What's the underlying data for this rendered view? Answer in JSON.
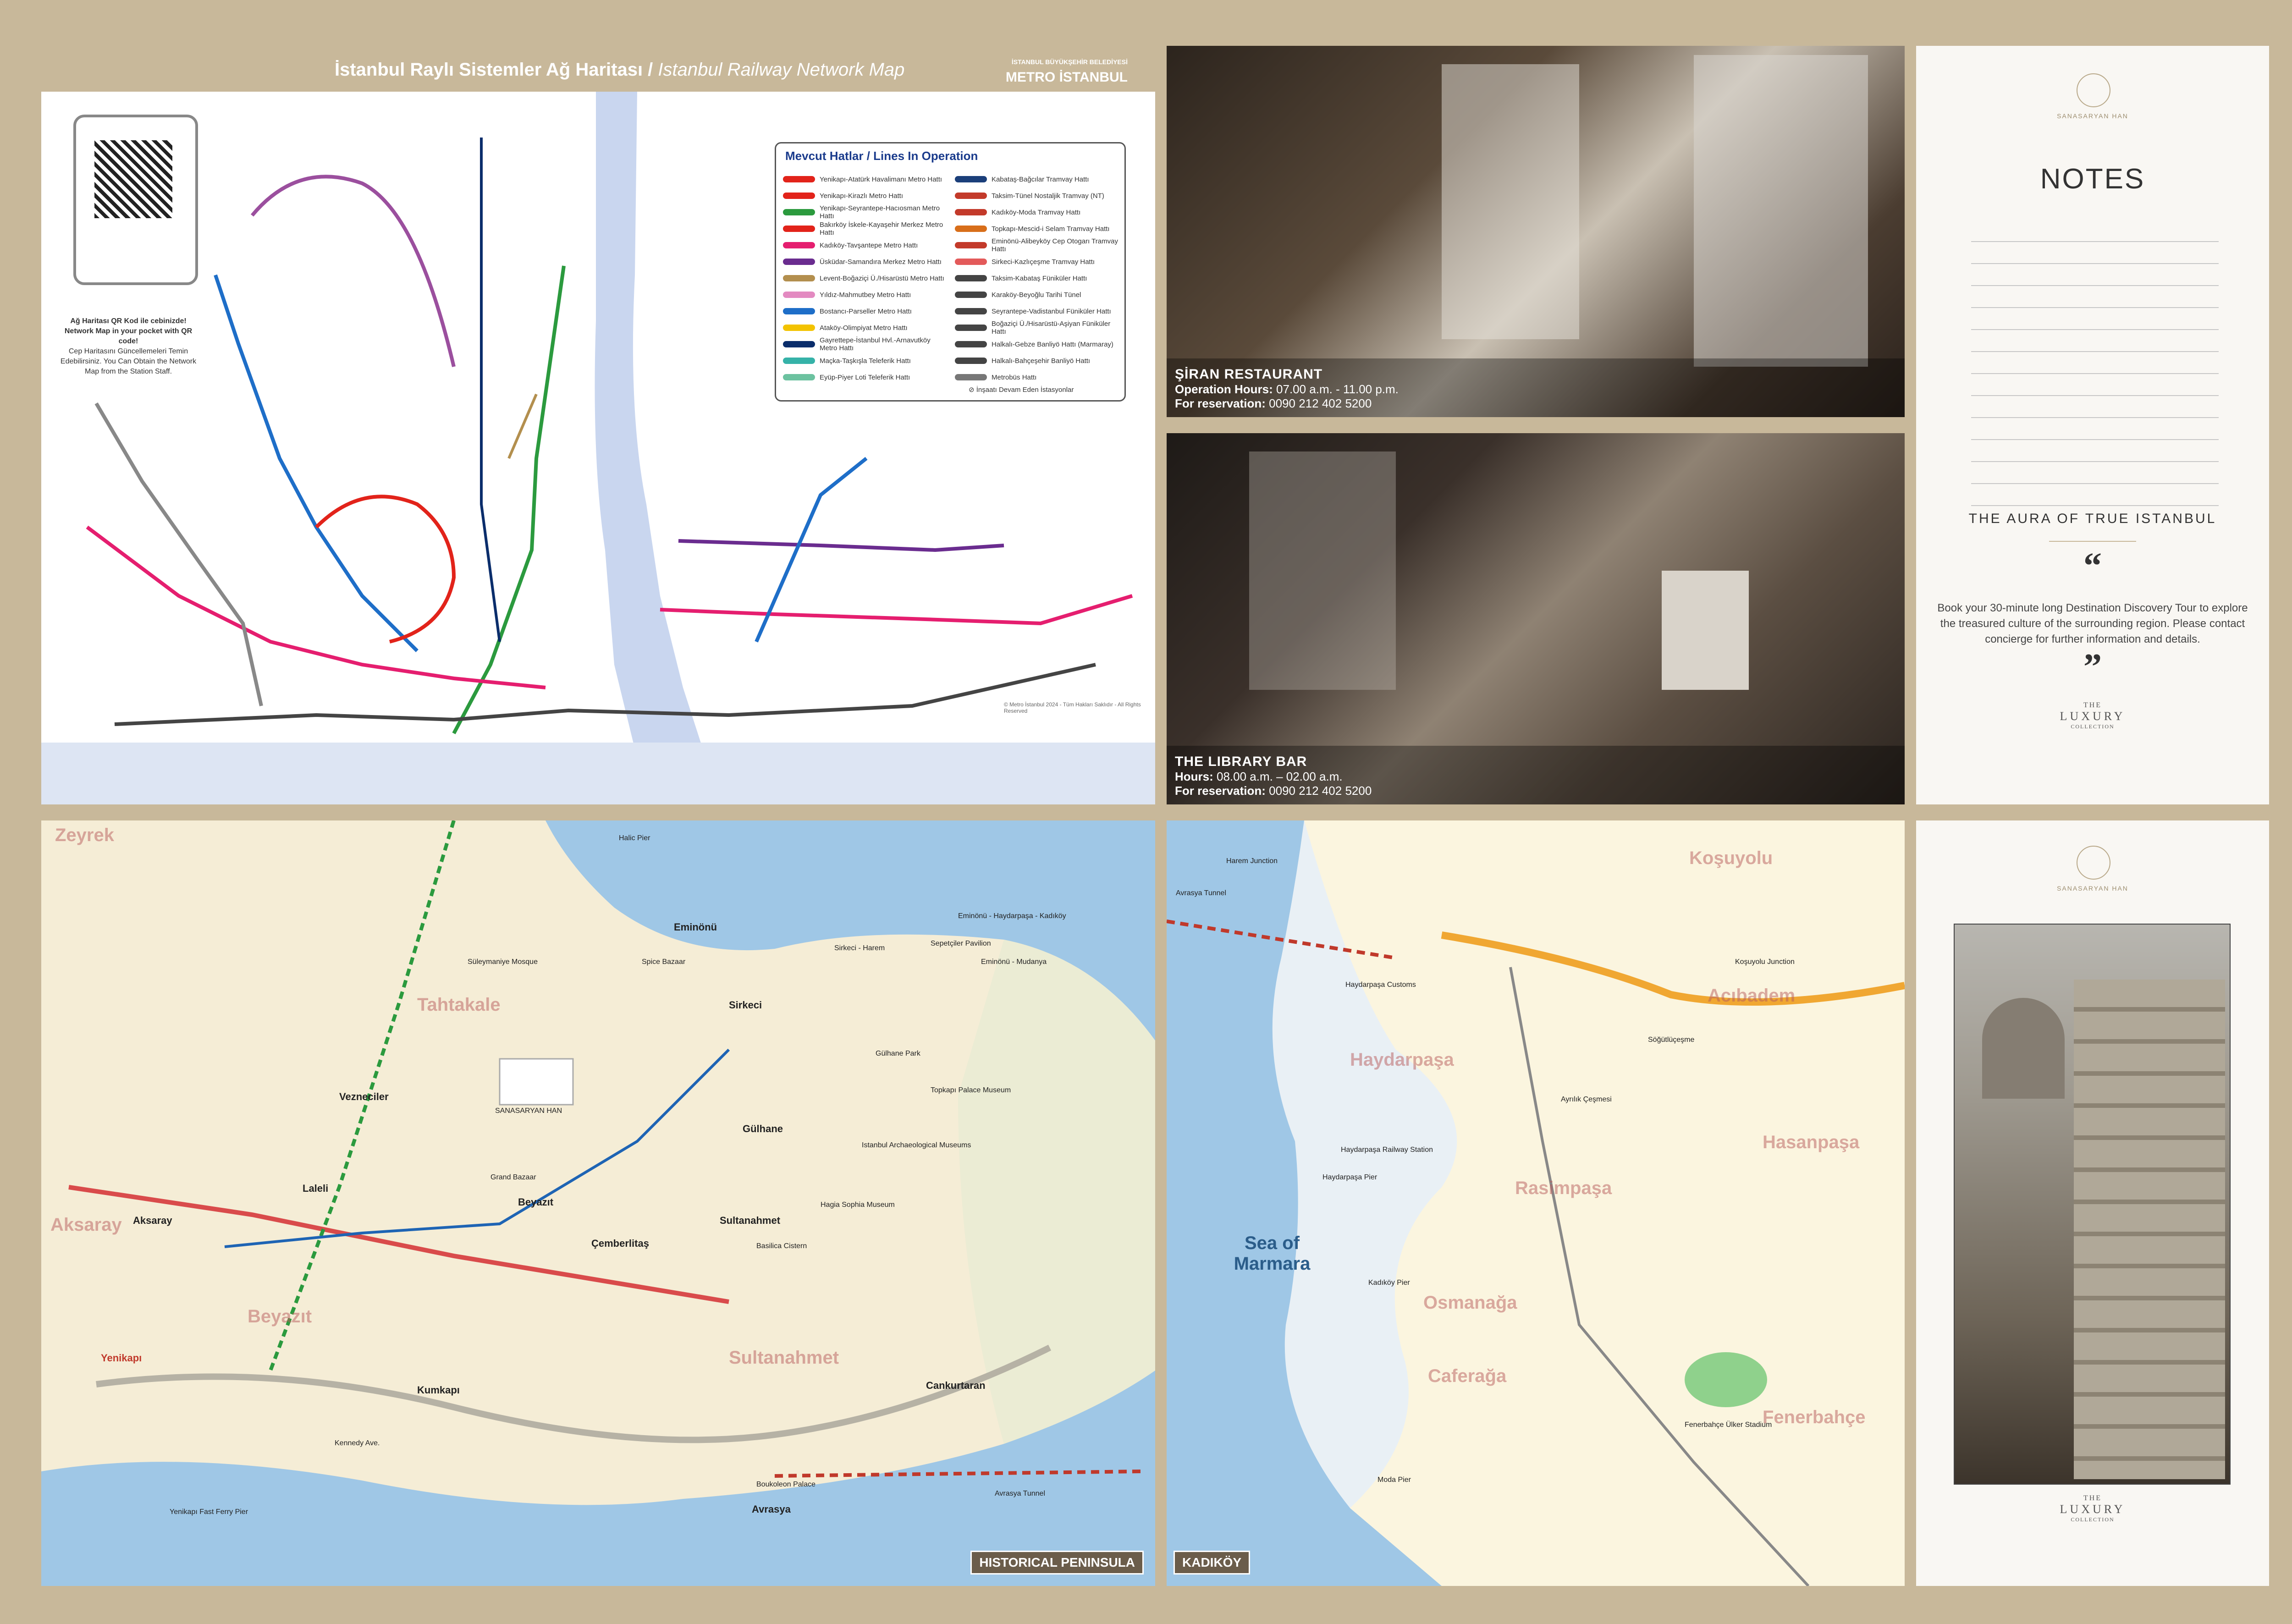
{
  "metro": {
    "title_tr": "İstanbul Raylı Sistemler Ağ Haritası / ",
    "title_en": "Istanbul Railway Network Map",
    "brand_left": "İSTANBUL BÜYÜKŞEHİR BELEDİYESİ",
    "brand_right": "METRO İSTANBUL",
    "qr_title_tr": "Ağ Haritası QR Kod ile cebinizde!",
    "qr_title_en": "Network Map in your pocket with QR code!",
    "qr_sub": "Cep Haritasını Güncellemeleri Temin Edebilirsiniz. You Can Obtain the Network Map from the Station Staff.",
    "legend_title": "Mevcut Hatlar / Lines In Operation",
    "legend_left": [
      {
        "label": "Yenikapı-Atatürk Havalimanı Metro Hattı",
        "color": "#e2231a"
      },
      {
        "label": "Yenikapı-Kirazlı Metro Hattı",
        "color": "#e2231a"
      },
      {
        "label": "Yenikapı-Seyrantepe-Hacıosman Metro Hattı",
        "color": "#2b9a3e"
      },
      {
        "label": "Bakırköy İskele-Kayaşehir Merkez Metro Hattı",
        "color": "#e2231a"
      },
      {
        "label": "Kadıköy-Tavşantepe Metro Hattı",
        "color": "#e51e6f"
      },
      {
        "label": "Üsküdar-Samandıra Merkez Metro Hattı",
        "color": "#6a2c8f"
      },
      {
        "label": "Levent-Boğaziçi Ü./Hisarüstü Metro Hattı",
        "color": "#b38f4e"
      },
      {
        "label": "Yıldız-Mahmutbey Metro Hattı",
        "color": "#e38ac1"
      },
      {
        "label": "Bostancı-Parseller Metro Hattı",
        "color": "#1e6ec8"
      },
      {
        "label": "Ataköy-Olimpiyat Metro Hattı",
        "color": "#f3c300"
      },
      {
        "label": "Gayrettepe-İstanbul Hvl.-Arnavutköy Metro Hattı",
        "color": "#0a2d6b"
      },
      {
        "label": "Maçka-Taşkışla Teleferik Hattı",
        "color": "#35b2a8"
      },
      {
        "label": "Eyüp-Piyer Loti Teleferik Hattı",
        "color": "#6cc2a0"
      }
    ],
    "legend_right": [
      {
        "label": "Kabataş-Bağcılar Tramvay Hattı",
        "color": "#1b3f7a"
      },
      {
        "label": "Taksim-Tünel Nostaljik Tramvay (NT)",
        "color": "#c33a2a"
      },
      {
        "label": "Kadıköy-Moda Tramvay Hattı",
        "color": "#c33a2a"
      },
      {
        "label": "Topkapı-Mescid-i Selam Tramvay Hattı",
        "color": "#d86e1a"
      },
      {
        "label": "Eminönü-Alibeyköy Cep Otogarı Tramvay Hattı",
        "color": "#c33a2a"
      },
      {
        "label": "Sirkeci-Kazlıçeşme Tramvay Hattı",
        "color": "#e35a5a"
      },
      {
        "label": "Taksim-Kabataş Füniküler Hattı",
        "color": "#444"
      },
      {
        "label": "Karaköy-Beyoğlu Tarihi Tünel",
        "color": "#444"
      },
      {
        "label": "Seyrantepe-Vadistanbul Füniküler Hattı",
        "color": "#444"
      },
      {
        "label": "Boğaziçi Ü./Hisarüstü-Aşiyan Füniküler Hattı",
        "color": "#444"
      },
      {
        "label": "Halkalı-Gebze Banliyö Hattı (Marmaray)",
        "color": "#444"
      },
      {
        "label": "Halkalı-Bahçeşehir Banliyö Hattı",
        "color": "#444"
      },
      {
        "label": "Metrobüs Hattı",
        "color": "#777"
      }
    ],
    "legend_note": "İnşaatı Devam Eden İstasyonlar",
    "copyright": "© Metro İstanbul 2024 - Tüm Hakları Saklıdır - All Rights Reserved"
  },
  "siran": {
    "title": "ŞİRAN RESTAURANT",
    "hours_label": "Operation Hours:",
    "hours_value": " 07.00 a.m. - 11.00 p.m.",
    "res_label": "For reservation:",
    "res_value": " 0090 212 402 5200"
  },
  "library": {
    "title": "THE LIBRARY BAR",
    "hours_label": "Hours:",
    "hours_value": " 08.00 a.m. – 02.00 a.m.",
    "res_label": "For reservation:",
    "res_value": " 0090 212 402 5200"
  },
  "notes": {
    "brand_caption": "SANASARYAN HAN",
    "title": "NOTES",
    "aura": "THE AURA OF TRUE ISTANBUL",
    "quote_open": "“",
    "quote_close": "”",
    "tour_text": "Book your 30-minute long Destination Discovery Tour to explore the treasured culture of the surrounding region. Please contact concierge for further information and details.",
    "lux_the": "THE",
    "lux_name": "LUXURY",
    "lux_collection": "COLLECTION"
  },
  "hist_map": {
    "badge": "HISTORICAL PENINSULA",
    "labels": [
      {
        "t": "Zeyrek",
        "c": "big"
      },
      {
        "t": "Tahtakale",
        "c": "big"
      },
      {
        "t": "Aksaray",
        "c": "big"
      },
      {
        "t": "Beyazıt",
        "c": "big"
      },
      {
        "t": "Sultanahmet",
        "c": "big"
      },
      {
        "t": "Vezneciler",
        "c": ""
      },
      {
        "t": "Eminönü",
        "c": ""
      },
      {
        "t": "Sirkeci",
        "c": ""
      },
      {
        "t": "Gülhane",
        "c": ""
      },
      {
        "t": "Laleli",
        "c": ""
      },
      {
        "t": "Aksaray",
        "c": ""
      },
      {
        "t": "Yenikapı",
        "c": "red"
      },
      {
        "t": "Kumkapı",
        "c": ""
      },
      {
        "t": "Çemberlitaş",
        "c": ""
      },
      {
        "t": "Beyazıt",
        "c": ""
      },
      {
        "t": "Sultanahmet",
        "c": ""
      },
      {
        "t": "Cankurtaran",
        "c": ""
      },
      {
        "t": "Topkapı Palace Museum",
        "c": "sm"
      },
      {
        "t": "Hagia Sophia Museum",
        "c": "sm"
      },
      {
        "t": "Grand Bazaar",
        "c": "sm"
      },
      {
        "t": "Süleymaniye Mosque",
        "c": "sm"
      },
      {
        "t": "Spice Bazaar",
        "c": "sm"
      },
      {
        "t": "Gülhane Park",
        "c": "sm"
      },
      {
        "t": "Istanbul Archaeological Museums",
        "c": "sm"
      },
      {
        "t": "Basilica Cistern",
        "c": "sm"
      },
      {
        "t": "Boukoleon Palace",
        "c": "sm"
      },
      {
        "t": "Avrasya",
        "c": ""
      },
      {
        "t": "Avrasya Tunnel",
        "c": "sm"
      },
      {
        "t": "Kennedy Ave.",
        "c": "sm"
      },
      {
        "t": "Sepetçiler Pavilion",
        "c": "sm"
      },
      {
        "t": "Halic Pier",
        "c": "sm"
      },
      {
        "t": "Yenikapı Fast Ferry Pier",
        "c": "sm"
      },
      {
        "t": "Eminönü - Haydarpaşa - Kadıköy",
        "c": "sm"
      },
      {
        "t": "Eminönü - Mudanya",
        "c": "sm"
      },
      {
        "t": "Sirkeci - Harem",
        "c": "sm"
      },
      {
        "t": "SANASARYAN HAN",
        "c": "sm"
      }
    ]
  },
  "kad_map": {
    "badge": "KADIKÖY",
    "labels": [
      {
        "t": "Sea of Marmara",
        "c": "sea"
      },
      {
        "t": "Harem Junction",
        "c": "sm"
      },
      {
        "t": "Haydarpaşa Customs",
        "c": "sm"
      },
      {
        "t": "Haydarpaşa Railway Station",
        "c": "sm"
      },
      {
        "t": "Haydarpaşa Pier",
        "c": "sm"
      },
      {
        "t": "Kadıköy Pier",
        "c": "sm"
      },
      {
        "t": "Moda Pier",
        "c": "sm"
      },
      {
        "t": "Haydarpaşa",
        "c": "big"
      },
      {
        "t": "Acıbadem",
        "c": "big"
      },
      {
        "t": "Hasanpaşa",
        "c": "big"
      },
      {
        "t": "Rasimpaşa",
        "c": "big"
      },
      {
        "t": "Osmanağa",
        "c": "big"
      },
      {
        "t": "Caferağa",
        "c": "big"
      },
      {
        "t": "Koşuyolu",
        "c": "big"
      },
      {
        "t": "Fenerbahçe",
        "c": "big"
      },
      {
        "t": "Koşuyolu Junction",
        "c": "sm"
      },
      {
        "t": "Söğütlüçeşme",
        "c": "sm"
      },
      {
        "t": "Ayrılık Çeşmesi",
        "c": "sm"
      },
      {
        "t": "Fenerbahçe Ülker Stadium",
        "c": "sm"
      },
      {
        "t": "Avrasya Tunnel",
        "c": "sm"
      }
    ]
  },
  "cover": {
    "brand_caption": "SANASARYAN HAN",
    "lux_the": "THE",
    "lux_name": "LUXURY",
    "lux_collection": "COLLECTION"
  }
}
